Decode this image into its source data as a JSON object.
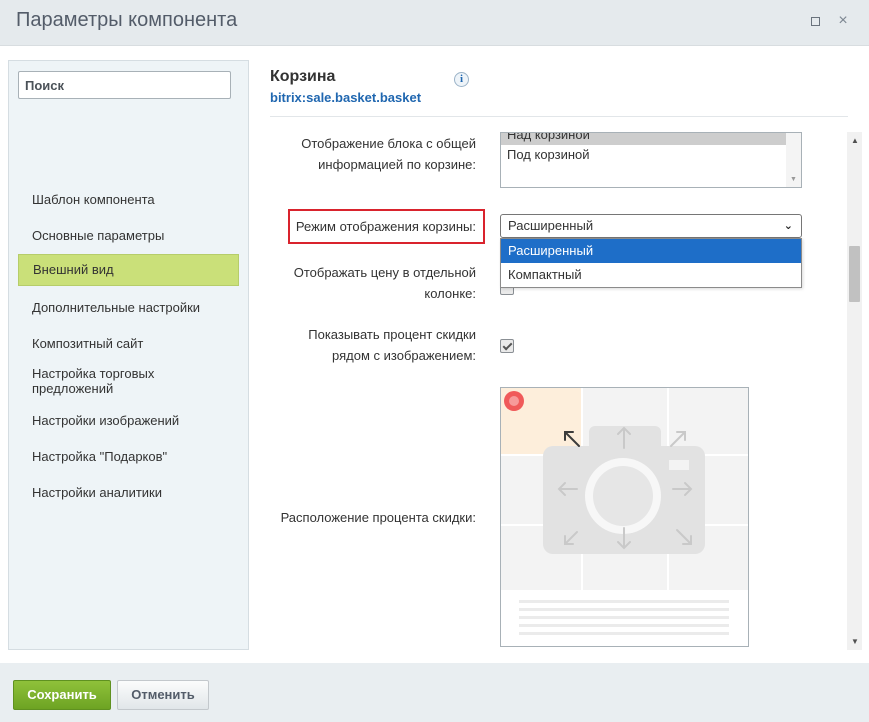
{
  "window": {
    "title": "Параметры компонента",
    "maximize_icon": "maximize-icon",
    "close_icon": "close-icon",
    "close_glyph": "×"
  },
  "sidebar": {
    "search_placeholder": "Поиск",
    "items": [
      {
        "label": "Шаблон компонента"
      },
      {
        "label": "Основные параметры"
      },
      {
        "label": "Внешний вид",
        "active": true
      },
      {
        "label": "Дополнительные настройки"
      },
      {
        "label": "Композитный сайт"
      },
      {
        "label": "Настройка торговых предложений"
      },
      {
        "label": "Настройки изображений"
      },
      {
        "label": "Настройка \"Подарков\""
      },
      {
        "label": "Настройки аналитики"
      }
    ]
  },
  "main": {
    "component_title": "Корзина",
    "component_code": "bitrix:sale.basket.basket",
    "info_glyph": "i",
    "fields": {
      "basket_info_block": {
        "label_line1": "Отображение блока с общей",
        "label_line2": "информацией по корзине:",
        "options": [
          "Над корзиной",
          "Под корзиной"
        ],
        "selected": "Над корзиной"
      },
      "basket_mode": {
        "label": "Режим отображения корзины:",
        "value": "Расширенный",
        "options": [
          "Расширенный",
          "Компактный"
        ],
        "highlighted": "Расширенный"
      },
      "price_column": {
        "label_line1": "Отображать цену в отдельной",
        "label_line2": "колонке:"
      },
      "discount_near_image": {
        "label_line1": "Показывать процент скидки",
        "label_line2": "рядом с изображением:",
        "checked": true
      },
      "discount_position": {
        "label": "Расположение процента скидки:",
        "selected_position": "top-left"
      }
    }
  },
  "footer": {
    "save_label": "Сохранить",
    "cancel_label": "Отменить"
  },
  "colors": {
    "active_nav": "#cae079",
    "save_button": "#7cb12b",
    "highlight": "#1e6ec8",
    "link": "#2067b0",
    "alert_box": "#d9232d",
    "badge": "#f05a5a",
    "selected_cell": "#fdeedb"
  }
}
